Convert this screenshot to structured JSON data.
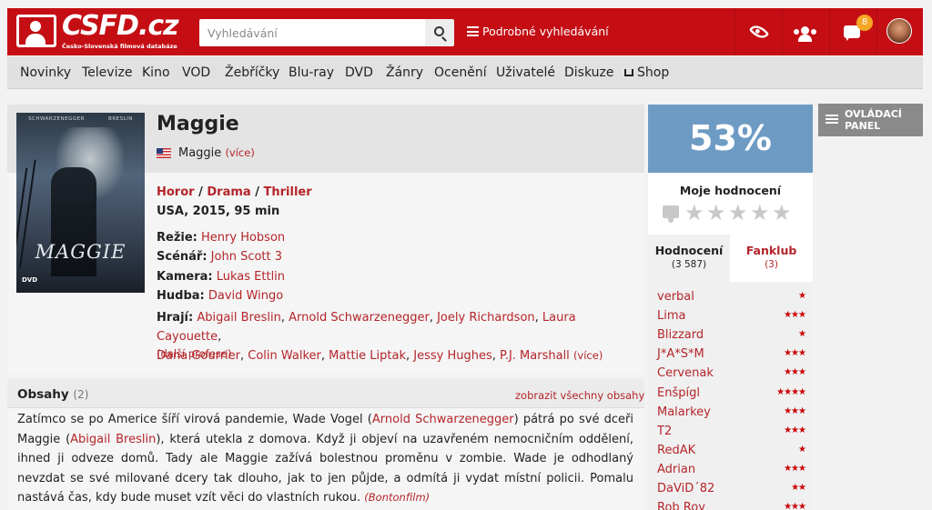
{
  "header": {
    "logo_text": "CSFD.cz",
    "logo_subtitle": "Česko-Slovenská filmová databáze",
    "search_placeholder": "Vyhledávání",
    "advanced_search": "Podrobné vyhledávání",
    "notification_count": "8"
  },
  "nav": {
    "items": [
      "Novinky",
      "Televize",
      "Kino",
      "VOD",
      "Žebříčky",
      "Blu-ray",
      "DVD",
      "Žánry",
      "Ocenění",
      "Uživatelé",
      "Diskuze",
      "Shop"
    ]
  },
  "poster": {
    "actor_left": "SCHWARZENEGGER",
    "actor_right": "BRESLIN",
    "title": "MAGGIE",
    "format": "DVD"
  },
  "film": {
    "title": "Maggie",
    "original_title": "Maggie",
    "original_more": "(více)",
    "genres": [
      "Horor",
      "Drama",
      "Thriller"
    ],
    "origin": "USA, 2015, 95 min",
    "crew": [
      {
        "label": "Režie:",
        "names": "Henry Hobson"
      },
      {
        "label": "Scénář:",
        "names": "John Scott 3"
      },
      {
        "label": "Kamera:",
        "names": "Lukas Ettlin"
      },
      {
        "label": "Hudba:",
        "names": "David Wingo"
      }
    ],
    "cast_label": "Hrají:",
    "cast": [
      "Abigail Breslin",
      "Arnold Schwarzenegger",
      "Joely Richardson",
      "Laura Cayouette",
      "Dana Gourrier",
      "Colin Walker",
      "Mattie Liptak",
      "Jessy Hughes",
      "P.J. Marshall"
    ],
    "cast_more": "(více)",
    "more_professions": "(další profese)"
  },
  "plot": {
    "title": "Obsahy",
    "count": "(2)",
    "show_all": "zobrazit všechny obsahy",
    "text_1": "Zatímco se po Americe šíří virová pandemie, Wade Vogel (",
    "link_1": "Arnold Schwarzenegger",
    "text_2": ") pátrá po své dceři Maggie (",
    "link_2": "Abigail Breslin",
    "text_3": "), která utekla z domova. Když ji objeví na uzavřeném nemocničním oddělení, ihned ji odveze domů. Tady ale Maggie zažívá bolestnou proměnu v zombie. Wade je odhodlaný nevzdat se své milované dcery tak dlouho, jak to jen půjde, a odmítá ji vydat místní policii. Pomalu nastává čas, kdy bude muset vzít věci do vlastních rukou.",
    "source": "(Bontonfilm)"
  },
  "rating": {
    "percent": "53%",
    "my_rating_label": "Moje hodnocení",
    "tab_ratings": "Hodnocení",
    "tab_ratings_count": "(3 587)",
    "tab_fanclub": "Fanklub",
    "tab_fanclub_count": "(3)",
    "color": "#6e9bc4"
  },
  "raters": [
    {
      "name": "verbal",
      "stars": "★"
    },
    {
      "name": "Lima",
      "stars": "★★★"
    },
    {
      "name": "Blizzard",
      "stars": "★"
    },
    {
      "name": "J*A*S*M",
      "stars": "★★★"
    },
    {
      "name": "Cervenak",
      "stars": "★★★"
    },
    {
      "name": "Enšpígl",
      "stars": "★★★★"
    },
    {
      "name": "Malarkey",
      "stars": "★★★"
    },
    {
      "name": "T2",
      "stars": "★★★"
    },
    {
      "name": "RedAK",
      "stars": "★"
    },
    {
      "name": "Adrian",
      "stars": "★★★"
    },
    {
      "name": "DaViD´82",
      "stars": "★★"
    },
    {
      "name": "Rob Roy",
      "stars": "★★★"
    }
  ],
  "control_panel": {
    "label": "OVLÁDACÍ PANEL"
  },
  "colors": {
    "brand_red": "#c40e14",
    "link_red": "#b4252a"
  }
}
